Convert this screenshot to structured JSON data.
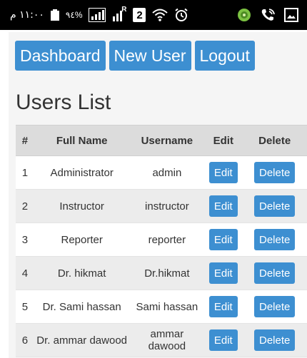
{
  "status_bar": {
    "time": "١١:٠٠ م",
    "battery": "٩٤%",
    "sim_label": "R",
    "sim_number": "2"
  },
  "nav": {
    "dashboard_label": "Dashboard",
    "new_user_label": "New User",
    "logout_label": "Logout"
  },
  "page": {
    "title": "Users List"
  },
  "table": {
    "headers": {
      "num": "#",
      "full_name": "Full Name",
      "username": "Username",
      "edit": "Edit",
      "delete": "Delete"
    },
    "rows": [
      {
        "num": "1",
        "full_name": "Administrator",
        "username": "admin",
        "edit": "Edit",
        "delete": "Delete"
      },
      {
        "num": "2",
        "full_name": "Instructor",
        "username": "instructor",
        "edit": "Edit",
        "delete": "Delete"
      },
      {
        "num": "3",
        "full_name": "Reporter",
        "username": "reporter",
        "edit": "Edit",
        "delete": "Delete"
      },
      {
        "num": "4",
        "full_name": "Dr. hikmat",
        "username": "Dr.hikmat",
        "edit": "Edit",
        "delete": "Delete"
      },
      {
        "num": "5",
        "full_name": "Dr. Sami hassan",
        "username": "Sami hassan",
        "edit": "Edit",
        "delete": "Delete"
      },
      {
        "num": "6",
        "full_name": "Dr. ammar dawood",
        "username": "ammar dawood",
        "edit": "Edit",
        "delete": "Delete"
      }
    ]
  },
  "colors": {
    "accent": "#3d8fd1",
    "status_bar": "#000000",
    "header_row": "#dcdcdc",
    "stripe": "#ececec"
  },
  "icons": [
    "battery-icon",
    "signal-icon",
    "sim-icon",
    "wifi-icon",
    "alarm-icon",
    "shield-app-icon",
    "call-icon",
    "gallery-icon"
  ]
}
